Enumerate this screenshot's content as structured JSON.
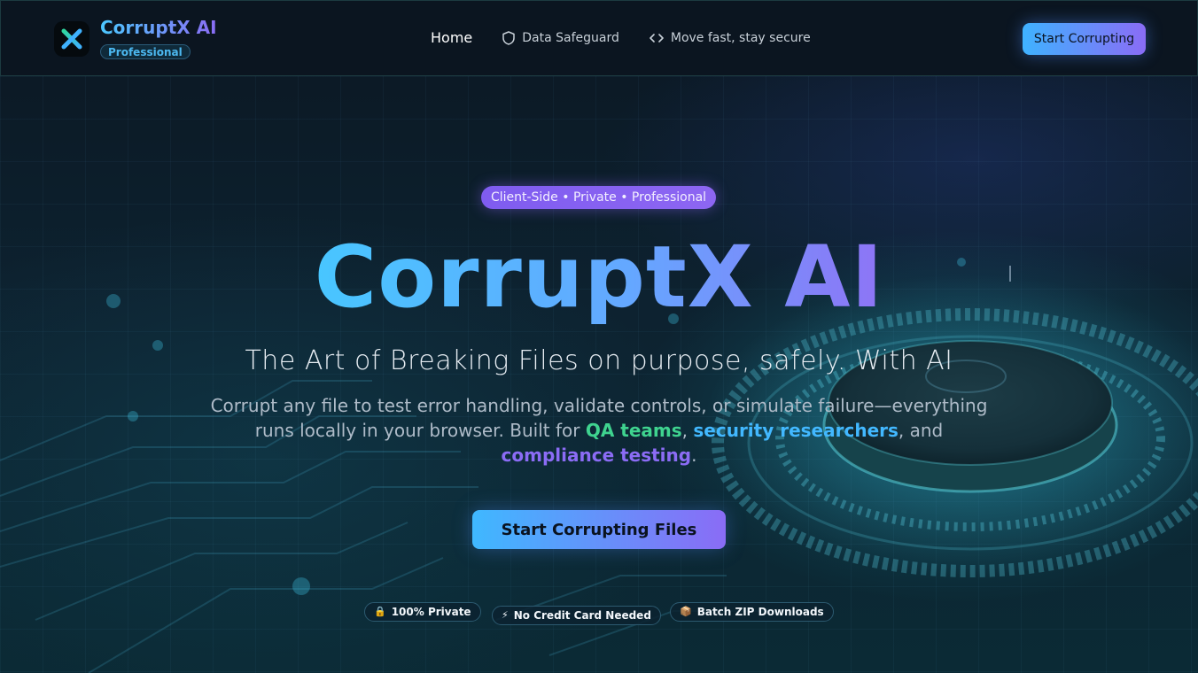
{
  "header": {
    "brand_name": "CorruptX AI",
    "brand_badge": "Professional",
    "nav": [
      {
        "label": "Home",
        "icon": ""
      },
      {
        "label": "Data Safeguard",
        "icon": "shield-icon"
      },
      {
        "label": "Move fast, stay secure",
        "icon": "code-icon"
      }
    ],
    "cta_label": "Start Corrupting"
  },
  "hero": {
    "pill": "Client-Side • Private • Professional",
    "title": "CorruptX AI",
    "subtitle": "The Art of Breaking Files on purpose, safely. With AI",
    "desc_part1": "Corrupt any file to test error handling, validate controls, or simulate failure—everything runs locally in your browser. Built for ",
    "desc_hl1": "QA teams",
    "desc_sep1": ", ",
    "desc_hl2": "security researchers",
    "desc_sep2": ", and ",
    "desc_hl3": "compliance testing",
    "desc_end": ".",
    "cta_label": "Start Corrupting Files",
    "chips": [
      {
        "icon": "🔒",
        "label": "100% Private"
      },
      {
        "icon": "⚡",
        "label": "No Credit Card Needed"
      },
      {
        "icon": "📦",
        "label": "Batch ZIP Downloads"
      }
    ]
  },
  "colors": {
    "accent_blue": "#42b8ff",
    "accent_purple": "#8b6cf5",
    "accent_green": "#3fd38f",
    "background": "#0b1722"
  }
}
